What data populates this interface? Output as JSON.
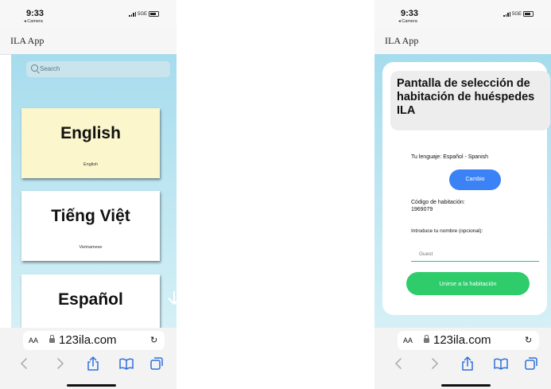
{
  "left": {
    "status": {
      "time": "9:33",
      "back": "◂ Camera",
      "network": "5GE"
    },
    "title": "ILA App",
    "search": {
      "placeholder": "Search"
    },
    "languages": [
      {
        "name": "English",
        "sub": "English"
      },
      {
        "name": "Tiếng Việt",
        "sub": "Vietnamese"
      },
      {
        "name": "Español",
        "sub": ""
      }
    ],
    "browser": {
      "aa": "AA",
      "url": "123ila.com",
      "reload": "↻"
    }
  },
  "right": {
    "status": {
      "time": "9:33",
      "back": "◂ Camera",
      "network": "5GE"
    },
    "title": "ILA App",
    "panel_title": "Pantalla de selección de habitación de huéspedes ILA",
    "language_label": "Tu lenguaje: Español - Spanish",
    "change_button": "Cambio",
    "room_code_label": "Código de habitación:",
    "room_code": "1969079",
    "name_label": "Introduce tu nombre (opcional):",
    "name_placeholder": "Guest",
    "join_button": "Unirse a la habitación",
    "browser": {
      "aa": "AA",
      "url": "123ila.com",
      "reload": "↻"
    }
  },
  "colors": {
    "accent_blue": "#3b82f6",
    "accent_green": "#2fcc6b",
    "bg_gradient_top": "#a6dced",
    "card_yellow": "#fbf6cc"
  }
}
